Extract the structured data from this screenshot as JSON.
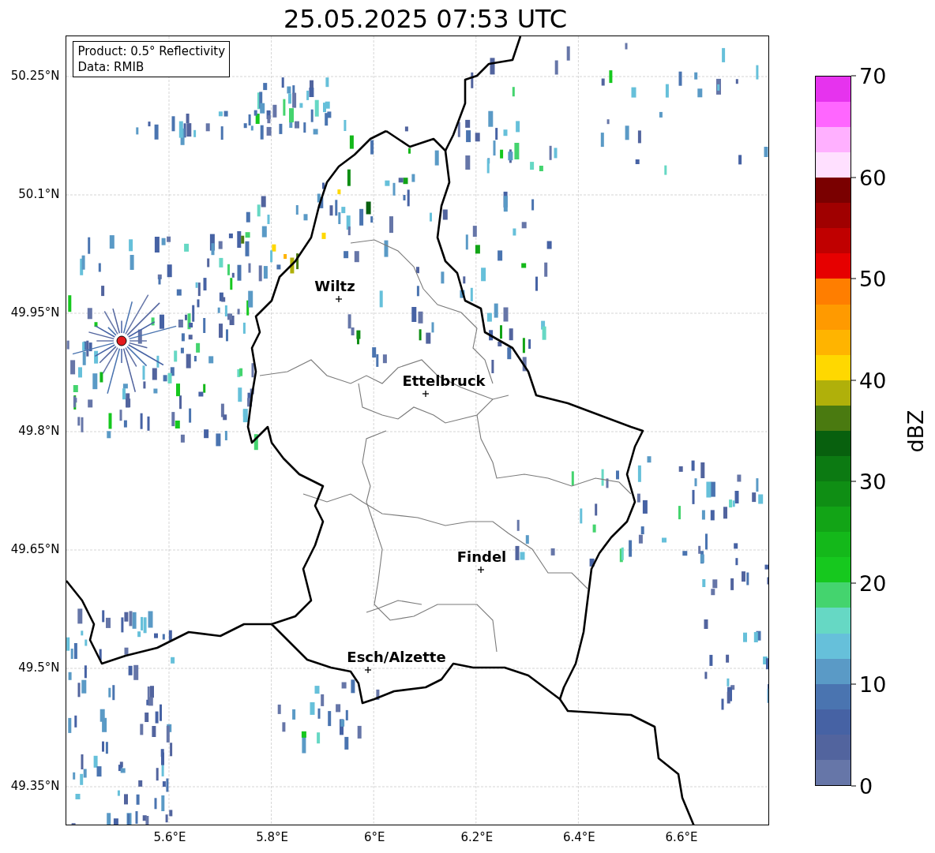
{
  "title": "25.05.2025 07:53 UTC",
  "legend": {
    "lines": [
      "Product: 0.5° Reflectivity",
      "Data: RMIB"
    ]
  },
  "cities": [
    {
      "name": "Wiltz"
    },
    {
      "name": "Ettelbruck"
    },
    {
      "name": "Findel"
    },
    {
      "name": "Esch/Alzette"
    }
  ],
  "lat_ticks": [
    "50.25°N",
    "50.1°N",
    "49.95°N",
    "49.8°N",
    "49.65°N",
    "49.5°N",
    "49.35°N"
  ],
  "lon_ticks": [
    "5.6°E",
    "5.8°E",
    "6°E",
    "6.2°E",
    "6.4°E",
    "6.6°E"
  ],
  "colorbar": {
    "label": "dBZ",
    "ticks": [
      "70",
      "60",
      "50",
      "40",
      "30",
      "20",
      "10",
      "0"
    ],
    "bins": [
      {
        "color": "#6676a8"
      },
      {
        "color": "#52649e"
      },
      {
        "color": "#4662a4"
      },
      {
        "color": "#4a74b0"
      },
      {
        "color": "#5a9ac6"
      },
      {
        "color": "#66c0da"
      },
      {
        "color": "#66d8c4"
      },
      {
        "color": "#44d46e"
      },
      {
        "color": "#16c81e"
      },
      {
        "color": "#14b81a"
      },
      {
        "color": "#12a416"
      },
      {
        "color": "#0f8e14"
      },
      {
        "color": "#0c7a12"
      },
      {
        "color": "#08600e"
      },
      {
        "color": "#4a7a10"
      },
      {
        "color": "#b0b00a"
      },
      {
        "color": "#ffd800"
      },
      {
        "color": "#ffb400"
      },
      {
        "color": "#ff9a00"
      },
      {
        "color": "#ff7e00"
      },
      {
        "color": "#e60000"
      },
      {
        "color": "#c00000"
      },
      {
        "color": "#a00000"
      },
      {
        "color": "#7a0000"
      },
      {
        "color": "#ffe0ff"
      },
      {
        "color": "#ffb0ff"
      },
      {
        "color": "#ff66ff"
      },
      {
        "color": "#e633ee"
      }
    ]
  }
}
